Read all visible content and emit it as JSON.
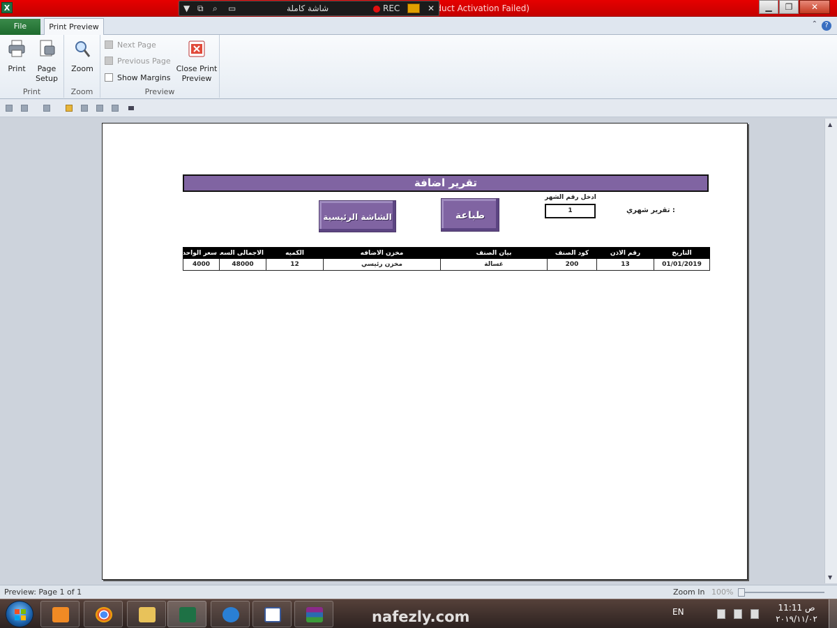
{
  "titlebar": {
    "title": "oduct Activation Failed)",
    "recorder": {
      "mode_label": "شاشة كاملة",
      "rec_label": "REC"
    },
    "minimize": "▁",
    "maximize": "❐",
    "close": "✕",
    "icons": [
      "excel-icon",
      "dropdown-icon",
      "restore-icon",
      "magnifier-icon",
      "window-icon",
      "record-icon",
      "camera-icon",
      "close-icon"
    ]
  },
  "ribbon": {
    "tabs": {
      "file": "File",
      "print_preview": "Print Preview"
    },
    "groups": {
      "print": {
        "label": "Print",
        "print_btn": "Print",
        "page_setup_line1": "Page",
        "page_setup_line2": "Setup"
      },
      "zoom": {
        "label": "Zoom",
        "zoom_btn": "Zoom"
      },
      "preview": {
        "label": "Preview",
        "next_page": "Next Page",
        "previous_page": "Previous Page",
        "show_margins": "Show Margins",
        "show_margins_checked": false,
        "close_line1": "Close Print",
        "close_line2": "Preview"
      }
    }
  },
  "report": {
    "title": "تقرير اضافة",
    "month_prompt": "ادخل رقم الشهر",
    "month_value": "1",
    "monthly_label": "تقرير شهري  :",
    "btn_print": "طباعة",
    "btn_main": "الشاشة الرئيسية",
    "accent_color": "#8064a2",
    "columns": [
      "التاريخ",
      "رقم الاذن",
      "كود الصنف",
      "بيان الصنف",
      "مخزن الاضافه",
      "الكميه",
      "الاجمالى  السعر",
      "سعر الواحد"
    ],
    "rows": [
      [
        "01/01/2019",
        "13",
        "200",
        "غسالة",
        "مخزن رئيسي",
        "12",
        "48000",
        "4000"
      ]
    ]
  },
  "statusbar": {
    "preview_text": "Preview: Page 1 of 1",
    "zoom_in": "Zoom In",
    "zoom_pct": "100%"
  },
  "taskbar": {
    "apps": [
      "media-player-icon",
      "chrome-icon",
      "explorer-icon",
      "excel-icon",
      "ie-icon",
      "calendar-icon",
      "winrar-icon"
    ],
    "watermark": "nafezly.com",
    "lang": "EN",
    "clock_time": "11:11 ص",
    "clock_date": "٢٠١٩/١١/٠٢"
  }
}
